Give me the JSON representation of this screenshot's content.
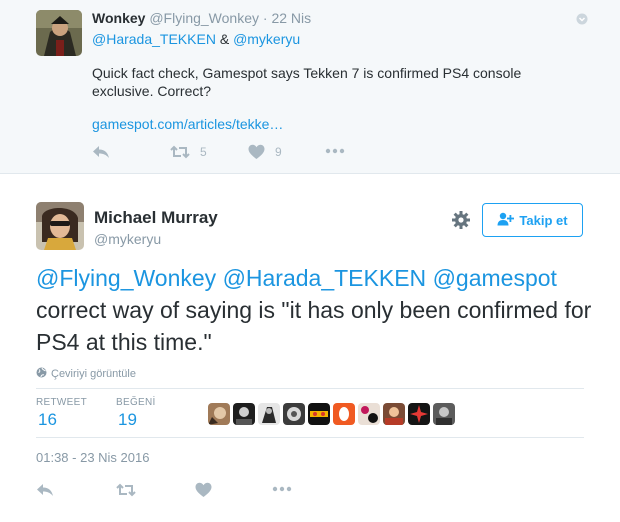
{
  "parent_tweet": {
    "author_name": "Wonkey",
    "author_handle": "@Flying_Wonkey",
    "date": "22 Nis",
    "reply_to_1": "@Harada_TEKKEN",
    "reply_sep": " & ",
    "reply_to_2": "@mykeryu",
    "text": "Quick fact check, Gamespot says Tekken 7 is confirmed PS4 console exclusive. Correct?",
    "link": "gamespot.com/articles/tekke…",
    "retweet_count": "5",
    "like_count": "9",
    "icons": [
      "reply-icon",
      "retweet-icon",
      "heart-icon",
      "more-icon",
      "caret-down-icon"
    ]
  },
  "main_tweet": {
    "author_name": "Michael Murray",
    "author_handle": "@mykeryu",
    "follow_label": "Takip et",
    "text_mention_1": "@Flying_Wonkey",
    "text_mention_2": "@Harada_TEKKEN",
    "text_mention_3": "@gamespot",
    "text_body": " correct way of saying is \"it has only been confirmed for PS4 at this time.\"",
    "translate_label": "Çeviriyi görüntüle",
    "retweet_label": "RETWEET",
    "retweet_count": "16",
    "like_label": "BEĞENİ",
    "like_count": "19",
    "timestamp": "01:38 - 23 Nis 2016",
    "icons": [
      "gear-icon",
      "follow-icon",
      "globe-icon",
      "reply-icon",
      "retweet-icon",
      "heart-icon",
      "more-icon"
    ]
  },
  "colors": {
    "link": "#1b95e0",
    "accent": "#1da1f2",
    "muted": "#8899a6",
    "icon": "#aab8c2",
    "parent_bg": "#f5f8fa"
  }
}
